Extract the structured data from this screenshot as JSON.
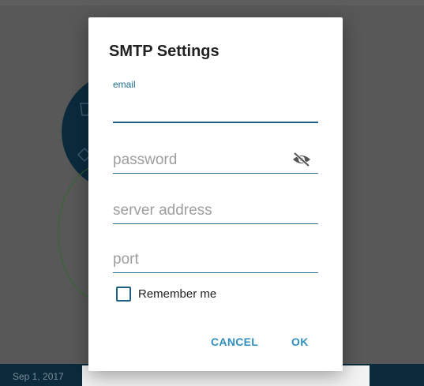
{
  "background": {
    "date_text": "Sep 1, 2017"
  },
  "dialog": {
    "title": "SMTP Settings",
    "email": {
      "label": "email",
      "value": ""
    },
    "password": {
      "placeholder": "password",
      "value": "",
      "toggle_icon": "eye-off-icon"
    },
    "server": {
      "placeholder": "server address",
      "value": ""
    },
    "port": {
      "placeholder": "port",
      "value": ""
    },
    "remember": {
      "label": "Remember me",
      "checked": false
    },
    "buttons": {
      "cancel": "CANCEL",
      "ok": "OK"
    }
  },
  "colors": {
    "accent": "#2f8fbf",
    "underline": "#1e5f82",
    "overlay": "#585858",
    "dark_navy": "#0b2b3d"
  }
}
